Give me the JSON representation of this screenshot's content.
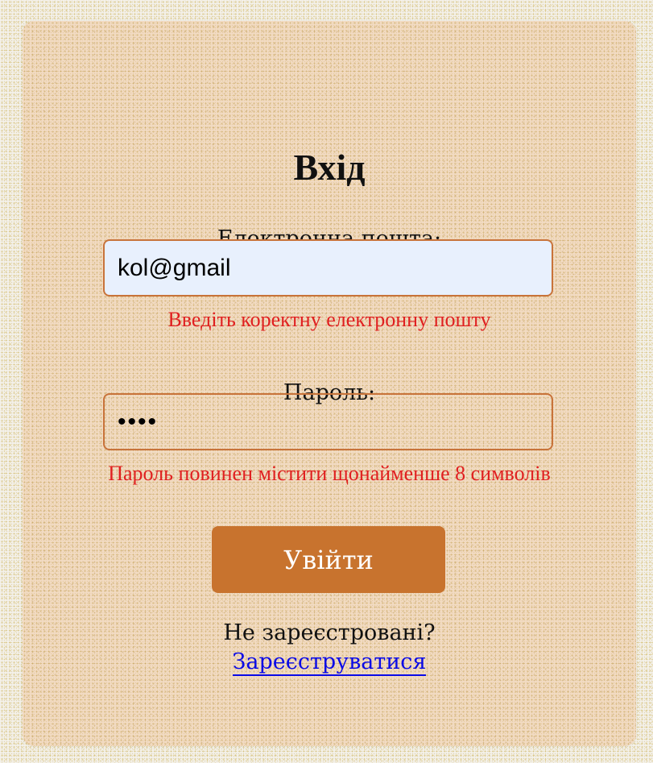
{
  "login_form": {
    "title": "Вхід",
    "email_label": "Електронна пошта:",
    "email_value": "kol@gmail",
    "email_error": "Введіть коректну електронну пошту",
    "password_label": "Пароль:",
    "password_value": "••••",
    "password_error": "Пароль повинен містити щонайменше 8 символів",
    "submit_label": "Увійти",
    "register_prompt": "Не зареєстровані?",
    "register_link": "Зареєструватися"
  },
  "colors": {
    "card_background": "#f2dbc3",
    "accent": "#c8732e",
    "error": "#e02020",
    "link": "#0a0ae6",
    "email_field_background": "#e8f0fd"
  }
}
